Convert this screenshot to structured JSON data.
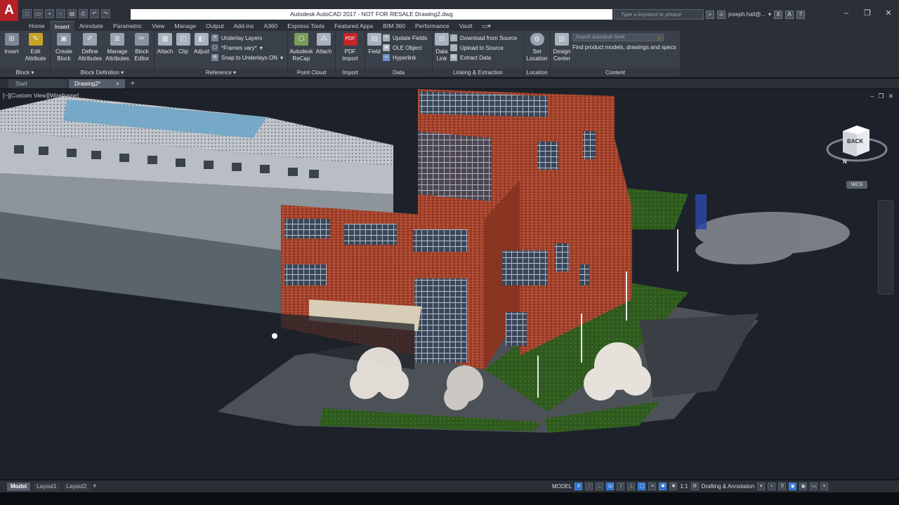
{
  "app": {
    "logo": "A",
    "title": "Autodesk AutoCAD 2017 - NOT FOR RESALE   Drawing2.dwg",
    "search_placeholder": "Type a keyword or phrase",
    "user": "joseph.hall@...",
    "qat_icons": [
      "new-icon",
      "open-icon",
      "save-icon",
      "save-as-icon",
      "plot-icon",
      "undo-icon",
      "redo-icon"
    ]
  },
  "ribbon_tabs": [
    {
      "label": "Home",
      "active": false
    },
    {
      "label": "Insert",
      "active": true
    },
    {
      "label": "Annotate",
      "active": false
    },
    {
      "label": "Parametric",
      "active": false
    },
    {
      "label": "View",
      "active": false
    },
    {
      "label": "Manage",
      "active": false
    },
    {
      "label": "Output",
      "active": false
    },
    {
      "label": "Add-ins",
      "active": false
    },
    {
      "label": "A360",
      "active": false
    },
    {
      "label": "Express Tools",
      "active": false
    },
    {
      "label": "Featured Apps",
      "active": false
    },
    {
      "label": "BIM 360",
      "active": false
    },
    {
      "label": "Performance",
      "active": false
    },
    {
      "label": "Vault",
      "active": false
    }
  ],
  "ribbon": {
    "block": {
      "title": "Block",
      "insert": "Insert",
      "edit_attribute_1": "Edit",
      "edit_attribute_2": "Attribute"
    },
    "block_definition": {
      "title": "Block Definition",
      "create_1": "Create",
      "create_2": "Block",
      "define_1": "Define",
      "define_2": "Attributes",
      "manage_1": "Manage",
      "manage_2": "Attributes",
      "editor_1": "Block",
      "editor_2": "Editor"
    },
    "reference": {
      "title": "Reference",
      "attach": "Attach",
      "clip": "Clip",
      "adjust": "Adjust",
      "underlay_layers": "Underlay Layers",
      "frames_vary": "*Frames vary*",
      "snap_to_underlays": "Snap to Underlays ON"
    },
    "point_cloud": {
      "title": "Point Cloud",
      "autodesk_recap_1": "Autodesk",
      "autodesk_recap_2": "ReCap",
      "attach": "Attach"
    },
    "import": {
      "title": "Import",
      "pdf_import_1": "PDF",
      "pdf_import_2": "Import"
    },
    "data": {
      "title": "Data",
      "field": "Field",
      "update_fields": "Update Fields",
      "ole_object": "OLE Object",
      "hyperlink": "Hyperlink"
    },
    "linking": {
      "title": "Linking & Extraction",
      "data_link_1": "Data",
      "data_link_2": "Link",
      "download_from_source": "Download from Source",
      "upload_to_source": "Upload to Source",
      "extract_data": "Extract  Data"
    },
    "location": {
      "title": "Location",
      "set_location_1": "Set",
      "set_location_2": "Location"
    },
    "content": {
      "title": "Content",
      "design_center_1": "Design",
      "design_center_2": "Center",
      "search_placeholder": "Search Autodesk Seek",
      "hint": "Find product models, drawings and specs"
    }
  },
  "file_tabs": {
    "start": "Start",
    "drawing": "Drawing2*",
    "close": "×",
    "plus": "+"
  },
  "viewport": {
    "label": "[−][Custom View][Wireframe]",
    "viewcube_face": "BACK",
    "compass": "N",
    "wcs": "WCS"
  },
  "layout_tabs": [
    {
      "label": "Model",
      "active": true
    },
    {
      "label": "Layout1",
      "active": false
    },
    {
      "label": "Layout2",
      "active": false
    }
  ],
  "status": {
    "model": "MODEL",
    "scale": "1:1",
    "workspace": "Drafting & Annotation"
  },
  "colors": {
    "title_bg": "#2b2f36",
    "ribbon_bg": "#3a404a",
    "viewport_bg": "#1d222a",
    "brick": "#9b3d2a",
    "lawn": "#2e5a1f",
    "accent_blue": "#2d6fd1",
    "logo_red": "#b32025"
  }
}
